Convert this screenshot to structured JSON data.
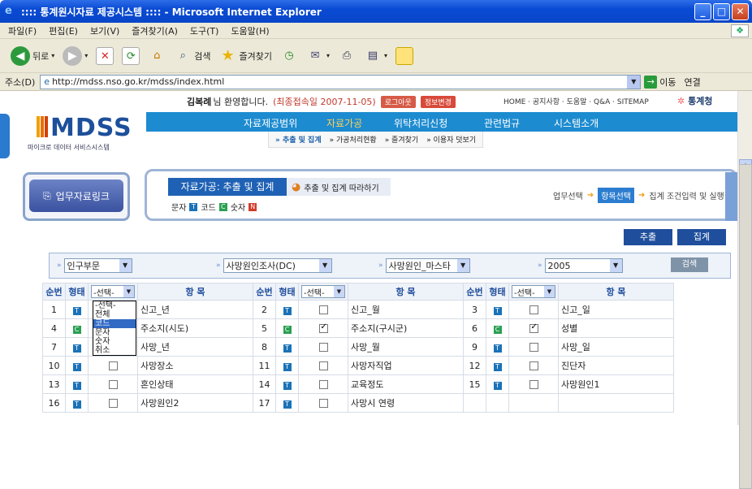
{
  "window": {
    "title": ":::: 통계원시자료 제공시스템 :::: - Microsoft Internet Explorer"
  },
  "menu": [
    "파일(F)",
    "편집(E)",
    "보기(V)",
    "즐겨찾기(A)",
    "도구(T)",
    "도움말(H)"
  ],
  "toolbar": {
    "back": "뒤로",
    "search": "검색",
    "favorites": "즐겨찾기"
  },
  "address": {
    "label": "주소(D)",
    "url": "http://mdss.nso.go.kr/mdss/index.html",
    "go": "이동",
    "links": "연결"
  },
  "header": {
    "welcome_name": "김복례",
    "welcome_text": "님 환영합니다.",
    "last_login": "(최종접속일 2007-11-05)",
    "logout": "로그아웃",
    "profile": "정보변경",
    "toplinks": "HOME · 공지사항 · 도움말 · Q&A · SITEMAP",
    "brand": "통계청",
    "logo": "MDSS",
    "logo_sub": "마이크로 데이터 서비스시스템"
  },
  "nav": [
    "자료제공범위",
    "자료가공",
    "위탁처리신청",
    "관련법규",
    "시스템소개"
  ],
  "subnav": [
    "» 추출 및 집계",
    "» 가공처리현황",
    "» 즐겨찾기",
    "» 이용자 덧보기"
  ],
  "left_button": "업무자료링크",
  "process": {
    "tab": "자료가공:  추출 및 집계",
    "tab2": "추출 및 집계 따라하기",
    "legend": [
      {
        "icon": "T",
        "label": "문자"
      },
      {
        "icon": "C",
        "label": "코드"
      },
      {
        "icon": "N",
        "label": "숫자"
      }
    ],
    "steps": {
      "s1": "업무선택",
      "s2": "항목선택",
      "s3": "집계 조건입력 및 실행"
    }
  },
  "buttons": {
    "extract": "추출",
    "aggregate": "집계",
    "search": "검색"
  },
  "filters": {
    "f1": "인구부문",
    "f2": "사망원인조사(DC)",
    "f3": "사망원인_마스타",
    "f4": "2005"
  },
  "table": {
    "headers": {
      "no": "순번",
      "type": "형태",
      "select": "-선택-",
      "item": "항 목"
    },
    "rows": [
      [
        {
          "no": "1",
          "type": "T",
          "chk": "dropdown",
          "item": "신고_년"
        },
        {
          "no": "2",
          "type": "T",
          "chk": false,
          "item": "신고_월"
        },
        {
          "no": "3",
          "type": "T",
          "chk": false,
          "item": "신고_일"
        }
      ],
      [
        {
          "no": "4",
          "type": "C",
          "chk": "dropdown",
          "item": "주소지(시도)"
        },
        {
          "no": "5",
          "type": "C",
          "chk": true,
          "item": "주소지(구시군)"
        },
        {
          "no": "6",
          "type": "C",
          "chk": true,
          "item": "성별"
        }
      ],
      [
        {
          "no": "7",
          "type": "T",
          "chk": "dropdown",
          "item": "사망_년"
        },
        {
          "no": "8",
          "type": "T",
          "chk": false,
          "item": "사망_월"
        },
        {
          "no": "9",
          "type": "T",
          "chk": false,
          "item": "사망_일"
        }
      ],
      [
        {
          "no": "10",
          "type": "T",
          "chk": false,
          "item": "사망장소"
        },
        {
          "no": "11",
          "type": "T",
          "chk": false,
          "item": "사망자직업"
        },
        {
          "no": "12",
          "type": "T",
          "chk": false,
          "item": "진단자"
        }
      ],
      [
        {
          "no": "13",
          "type": "T",
          "chk": false,
          "item": "혼인상태"
        },
        {
          "no": "14",
          "type": "T",
          "chk": false,
          "item": "교육정도"
        },
        {
          "no": "15",
          "type": "T",
          "chk": false,
          "item": "사망원인1"
        }
      ],
      [
        {
          "no": "16",
          "type": "T",
          "chk": false,
          "item": "사망원인2"
        },
        {
          "no": "17",
          "type": "T",
          "chk": false,
          "item": "사망시 연령"
        },
        null
      ]
    ]
  },
  "dropdown_options": [
    "-선택-",
    "전체",
    "코드",
    "문자",
    "숫자",
    "취소"
  ],
  "dropdown_selected": "코드"
}
